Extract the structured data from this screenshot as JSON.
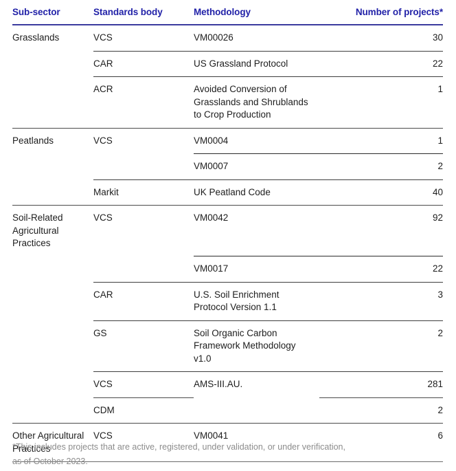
{
  "table": {
    "columns": [
      {
        "key": "sub_sector",
        "label": "Sub-sector",
        "align": "left"
      },
      {
        "key": "standards_body",
        "label": "Standards body",
        "align": "left"
      },
      {
        "key": "methodology",
        "label": "Methodology",
        "align": "left"
      },
      {
        "key": "number_of_projects",
        "label": "Number of projects*",
        "align": "right"
      }
    ],
    "rows": [
      {
        "sub_sector": "Grasslands",
        "standards_body": "VCS",
        "methodology": "VM00026",
        "number_of_projects": "30"
      },
      {
        "sub_sector": "",
        "standards_body": "CAR",
        "methodology": "US Grassland Protocol",
        "number_of_projects": "22"
      },
      {
        "sub_sector": "",
        "standards_body": "ACR",
        "methodology": "Avoided Conversion of Grasslands and Shrublands to Crop Production",
        "number_of_projects": "1"
      },
      {
        "sub_sector": "Peatlands",
        "standards_body": "VCS",
        "methodology": "VM0004",
        "number_of_projects": "1"
      },
      {
        "sub_sector": "",
        "standards_body": "",
        "methodology": "VM0007",
        "number_of_projects": "2"
      },
      {
        "sub_sector": "",
        "standards_body": "Markit",
        "methodology": "UK Peatland Code",
        "number_of_projects": "40"
      },
      {
        "sub_sector": "Soil-Related Agricultural Practices",
        "standards_body": "VCS",
        "methodology": "VM0042",
        "number_of_projects": "92"
      },
      {
        "sub_sector": "",
        "standards_body": "",
        "methodology": "VM0017",
        "number_of_projects": "22"
      },
      {
        "sub_sector": "",
        "standards_body": "CAR",
        "methodology": "U.S. Soil Enrichment Protocol Version 1.1",
        "number_of_projects": "3"
      },
      {
        "sub_sector": "",
        "standards_body": "GS",
        "methodology": "Soil Organic Carbon Framework Methodology v1.0",
        "number_of_projects": "2"
      },
      {
        "sub_sector": "",
        "standards_body": "VCS",
        "methodology": "AMS-III.AU.",
        "number_of_projects": "281"
      },
      {
        "sub_sector": "",
        "standards_body": "CDM",
        "methodology": "",
        "number_of_projects": "2"
      },
      {
        "sub_sector": "Other Agricultural Practices",
        "standards_body": "VCS",
        "methodology": "VM0041",
        "number_of_projects": "6"
      }
    ]
  },
  "footnote": {
    "line1": "*This includes projects that are active, registered, under validation, or under verification,",
    "line2": "as of October 2023."
  },
  "colors": {
    "header_text": "#2222a8",
    "header_rule": "#3a3a9e",
    "body_text": "#1d1d1d",
    "rule": "#4a4a4a",
    "footnote_text": "#8c8c8c",
    "background": "#ffffff"
  }
}
